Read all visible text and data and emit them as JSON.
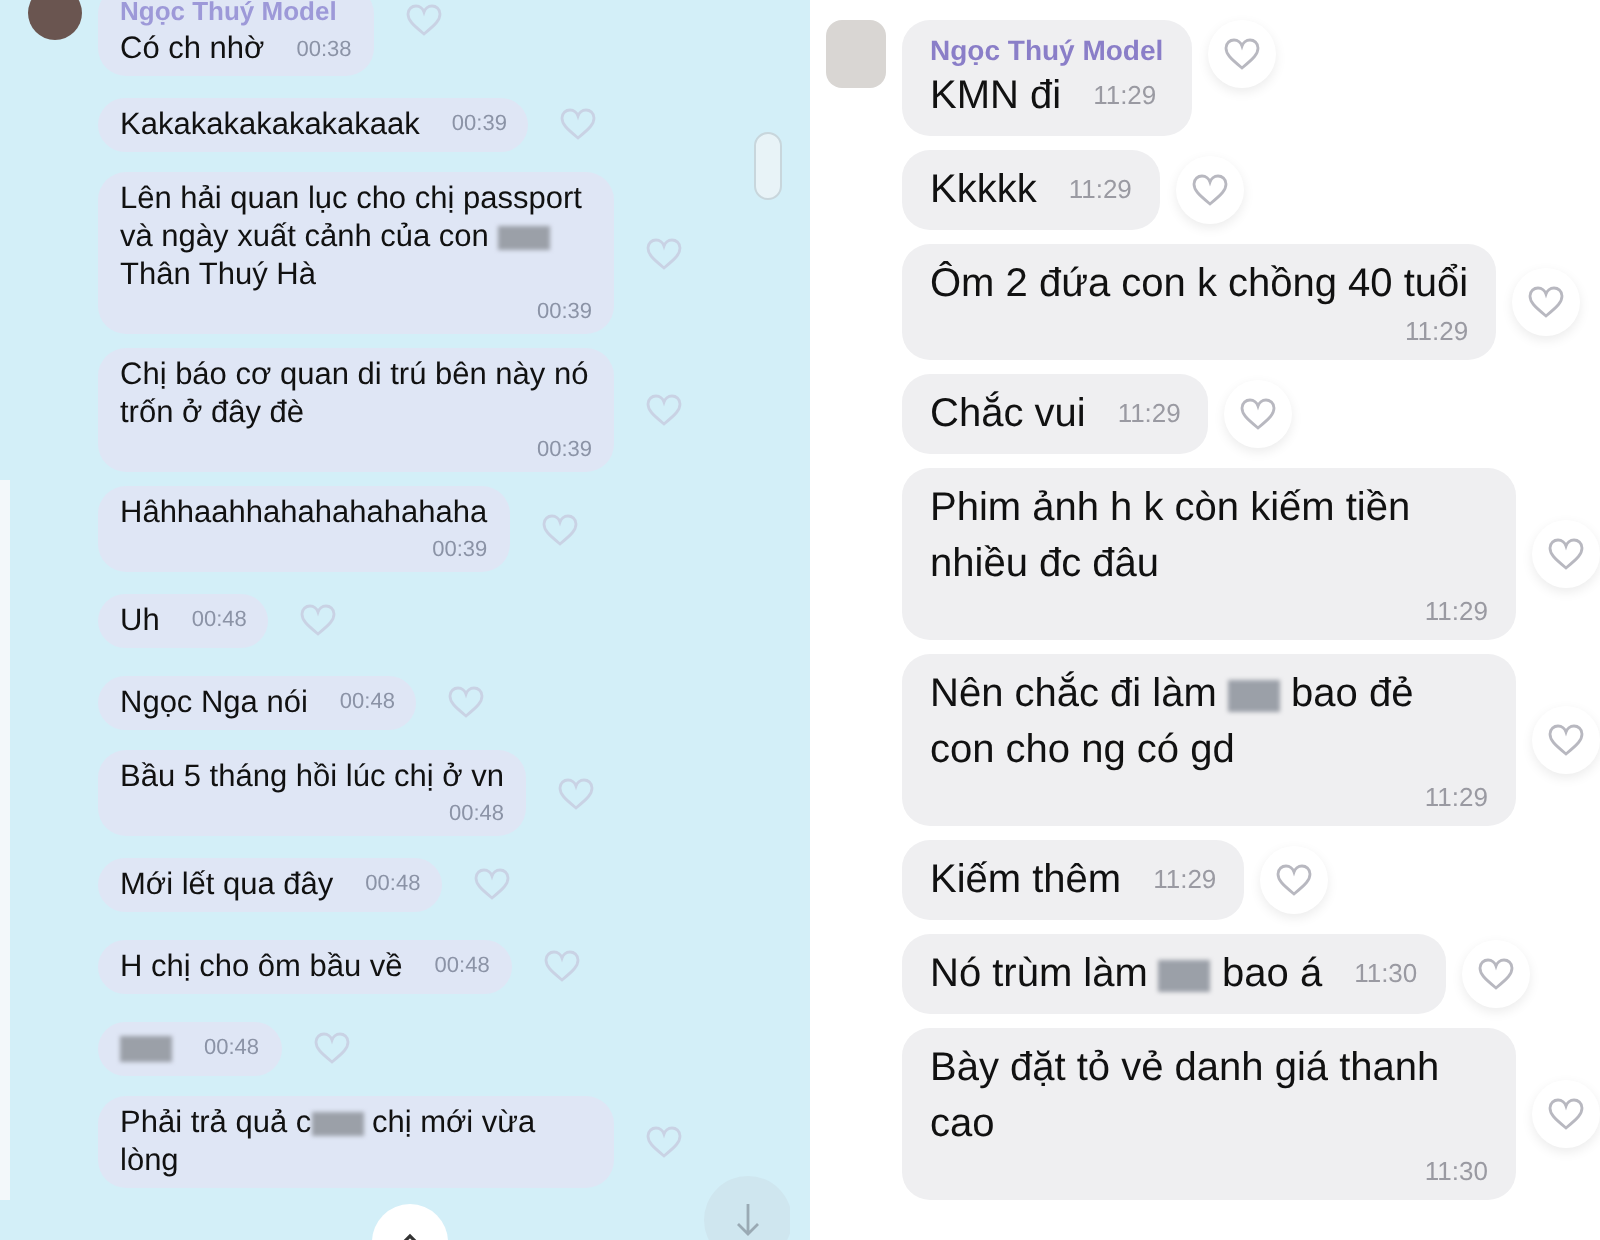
{
  "panels": [
    {
      "kind": "blue",
      "sender": "Ngọc Thuý Model",
      "messages": [
        {
          "kind": "inline",
          "time": "00:38",
          "parts": [
            {
              "kind": "text",
              "text": "Có ch nhờ"
            }
          ]
        },
        {
          "kind": "inline",
          "time": "00:39",
          "parts": [
            {
              "kind": "text",
              "text": "Kakakakakakakakaak"
            }
          ]
        },
        {
          "kind": "below",
          "time": "00:39",
          "parts": [
            {
              "kind": "text",
              "text": "Lên hải quan lục cho chị passport và ngày xuất cảnh của con "
            },
            {
              "kind": "blur"
            },
            {
              "kind": "text",
              "text": " Thân Thuý Hà"
            }
          ]
        },
        {
          "kind": "below",
          "time": "00:39",
          "parts": [
            {
              "kind": "text",
              "text": "Chị báo cơ quan di trú bên này nó trốn ở đây đè"
            }
          ]
        },
        {
          "kind": "below",
          "time": "00:39",
          "parts": [
            {
              "kind": "text",
              "text": "Hâhhaahhahahahahahaha"
            }
          ]
        },
        {
          "kind": "inline",
          "time": "00:48",
          "parts": [
            {
              "kind": "text",
              "text": "Uh"
            }
          ]
        },
        {
          "kind": "inline",
          "time": "00:48",
          "parts": [
            {
              "kind": "text",
              "text": "Ngọc Nga nói"
            }
          ]
        },
        {
          "kind": "below",
          "time": "00:48",
          "parts": [
            {
              "kind": "text",
              "text": "Bầu 5 tháng hồi lúc chị ở vn"
            }
          ]
        },
        {
          "kind": "inline",
          "time": "00:48",
          "parts": [
            {
              "kind": "text",
              "text": "Mới lết qua đây"
            }
          ]
        },
        {
          "kind": "inline",
          "time": "00:48",
          "parts": [
            {
              "kind": "text",
              "text": "H chị cho ôm bầu về"
            }
          ]
        },
        {
          "kind": "inline",
          "time": "00:48",
          "parts": [
            {
              "kind": "blur"
            }
          ]
        },
        {
          "kind": "notime",
          "parts": [
            {
              "kind": "text",
              "text": "Phải trả quả c"
            },
            {
              "kind": "blur"
            },
            {
              "kind": "text",
              "text": " chị mới vừa lòng"
            }
          ]
        }
      ]
    },
    {
      "kind": "white",
      "sender": "Ngọc Thuý Model",
      "messages": [
        {
          "kind": "inline",
          "time": "11:29",
          "parts": [
            {
              "kind": "text",
              "text": "KMN đi"
            }
          ]
        },
        {
          "kind": "inline",
          "time": "11:29",
          "parts": [
            {
              "kind": "text",
              "text": "Kkkkk"
            }
          ]
        },
        {
          "kind": "below",
          "time": "11:29",
          "parts": [
            {
              "kind": "text",
              "text": "Ôm 2 đứa con k chồng 40 tuổi"
            }
          ]
        },
        {
          "kind": "inline",
          "time": "11:29",
          "parts": [
            {
              "kind": "text",
              "text": "Chắc vui"
            }
          ]
        },
        {
          "kind": "below",
          "time": "11:29",
          "parts": [
            {
              "kind": "text",
              "text": "Phim ảnh h k còn kiếm tiền nhiều đc đâu"
            }
          ]
        },
        {
          "kind": "below",
          "time": "11:29",
          "parts": [
            {
              "kind": "text",
              "text": "Nên chắc đi làm "
            },
            {
              "kind": "blur"
            },
            {
              "kind": "text",
              "text": " bao đẻ con cho ng có gd"
            }
          ]
        },
        {
          "kind": "inline",
          "time": "11:29",
          "parts": [
            {
              "kind": "text",
              "text": "Kiếm thêm"
            }
          ]
        },
        {
          "kind": "inline",
          "time": "11:30",
          "parts": [
            {
              "kind": "text",
              "text": "Nó trùm làm "
            },
            {
              "kind": "blur"
            },
            {
              "kind": "text",
              "text": " bao á"
            }
          ]
        },
        {
          "kind": "below",
          "time": "11:30",
          "parts": [
            {
              "kind": "text",
              "text": "Bày đặt tỏ vẻ danh giá thanh cao"
            }
          ]
        }
      ]
    }
  ]
}
